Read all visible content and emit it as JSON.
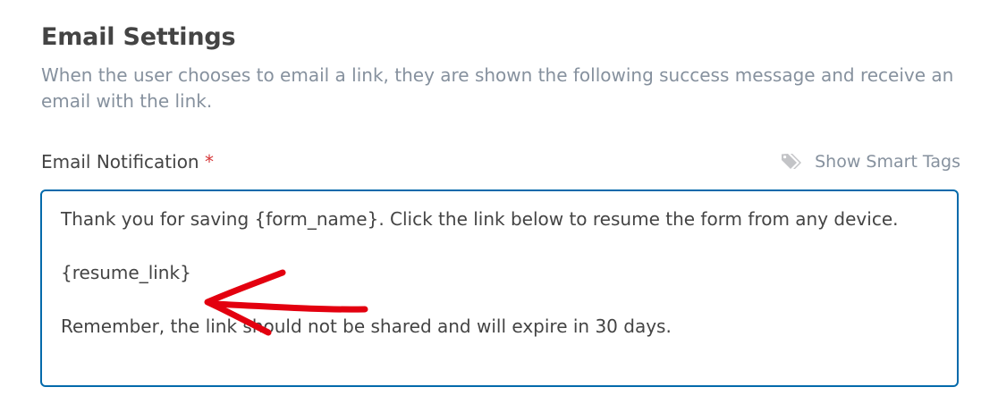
{
  "section": {
    "title": "Email Settings",
    "description": "When the user chooses to email a link, they are shown the following success message and receive an email with the link."
  },
  "email_notification": {
    "label": "Email Notification",
    "required_marker": "*",
    "smart_tags_label": "Show Smart Tags",
    "message_line_1": "Thank you for saving {form_name}. Click the link below to resume the form from any device.",
    "message_line_2": "{resume_link}",
    "message_line_3": "Remember, the link should not be shared and will expire in 30 days."
  },
  "colors": {
    "accent_border": "#036aab",
    "required": "#d63638",
    "muted_text": "#86919e",
    "annotation_arrow": "#e3000f"
  },
  "icons": {
    "smart_tags": "tag-icon",
    "annotation": "red-arrow-annotation"
  }
}
